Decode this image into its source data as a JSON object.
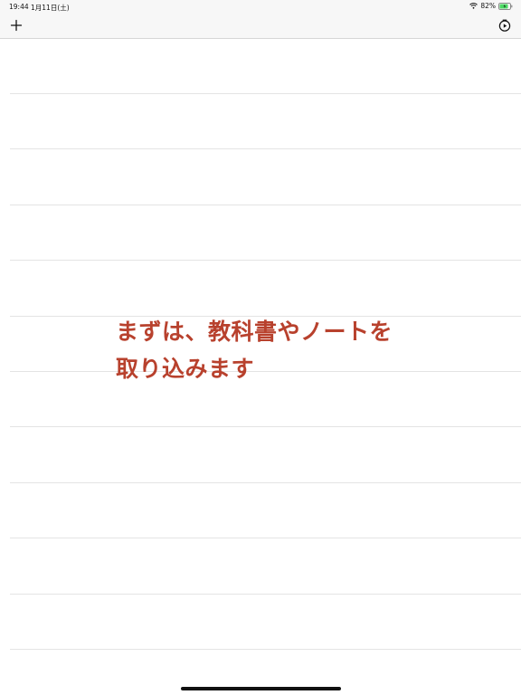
{
  "status_bar": {
    "time": "19:44",
    "date": "1月11日(土)",
    "battery_percent": "82%",
    "battery_level": 0.82,
    "charging": true,
    "icons": [
      "wifi-icon",
      "battery-icon"
    ]
  },
  "toolbar": {
    "add_icon": "plus-icon",
    "settings_icon": "timer-icon"
  },
  "list": {
    "row_count": 11
  },
  "hint": {
    "line1": "まずは、教科書やノートを",
    "line2": "取り込みます",
    "color": "#b8412d"
  }
}
